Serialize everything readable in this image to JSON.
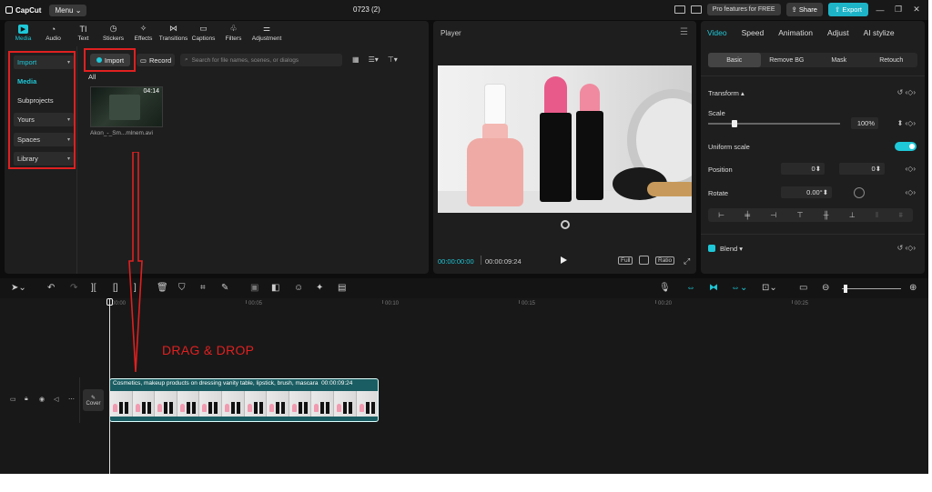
{
  "titlebar": {
    "logo": "CapCut",
    "menu": "Menu",
    "project": "0723 (2)",
    "pro": "Pro features for FREE",
    "share": "Share",
    "export": "Export"
  },
  "media_tabs": [
    {
      "label": "Media",
      "icon": "media-icon"
    },
    {
      "label": "Audio",
      "icon": "audio-icon"
    },
    {
      "label": "Text",
      "icon": "text-icon"
    },
    {
      "label": "Stickers",
      "icon": "sticker-icon"
    },
    {
      "label": "Effects",
      "icon": "effects-icon"
    },
    {
      "label": "Transitions",
      "icon": "transitions-icon"
    },
    {
      "label": "Captions",
      "icon": "captions-icon"
    },
    {
      "label": "Filters",
      "icon": "filters-icon"
    },
    {
      "label": "Adjustment",
      "icon": "adjustment-icon"
    }
  ],
  "sidebar": {
    "import": "Import",
    "media": "Media",
    "subprojects": "Subprojects",
    "yours": "Yours",
    "spaces": "Spaces",
    "library": "Library"
  },
  "content": {
    "import": "Import",
    "record": "Record",
    "search_placeholder": "Search for file names, scenes, or dialogs",
    "all": "All",
    "thumb_duration": "04:14",
    "thumb_name": "Akon_-_Sm...mlnem.avi"
  },
  "player": {
    "title": "Player",
    "current": "00:00:00:00",
    "total": "00:00:09:24",
    "full": "Full",
    "ratio": "Ratio"
  },
  "props": {
    "tabs": [
      "Video",
      "Speed",
      "Animation",
      "Adjust",
      "AI stylize"
    ],
    "subtabs": [
      "Basic",
      "Remove BG",
      "Mask",
      "Retouch"
    ],
    "transform": "Transform",
    "scale": "Scale",
    "scale_value": "100%",
    "scale_level": 0.2,
    "uniform": "Uniform scale",
    "position": "Position",
    "x_label": "X",
    "x_value": "0",
    "y_label": "Y",
    "y_value": "0",
    "rotate": "Rotate",
    "rotate_value": "0.00°",
    "blend": "Blend"
  },
  "timeline": {
    "ruler": [
      "00:00",
      "00:05",
      "00:10",
      "00:15",
      "00:20",
      "00:25"
    ],
    "cover": "Cover",
    "clip_label": "Cosmetics, makeup products on dressing vanity table, lipstick, brush, mascara",
    "clip_duration": "00:00:09:24"
  },
  "annotation": {
    "text": "DRAG & DROP",
    "color": "#e02020"
  },
  "colors": {
    "accent": "#1ec8d8",
    "annotation": "#e02020"
  }
}
